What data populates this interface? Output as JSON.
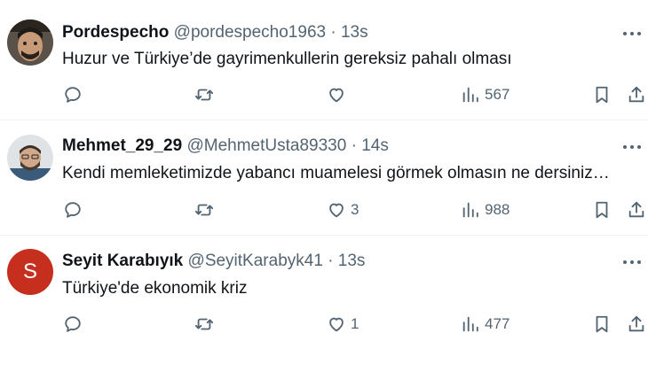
{
  "tweets": [
    {
      "name": "Pordespecho",
      "handle": "@pordespecho1963",
      "separator": "·",
      "time": "13s",
      "text": "Huzur ve Türkiye’de gayrimenkullerin gereksiz pahalı olması",
      "avatar_letter": "",
      "likes": "",
      "views": "567"
    },
    {
      "name": "Mehmet_29_29",
      "handle": "@MehmetUsta89330",
      "separator": "·",
      "time": "14s",
      "text": "Kendi memleketimizde yabancı muamelesi görmek olmasın ne dersiniz…",
      "avatar_letter": "",
      "likes": "3",
      "views": "988"
    },
    {
      "name": "Seyit Karabıyık",
      "handle": "@SeyitKarabyk41",
      "separator": "·",
      "time": "13s",
      "text": "Türkiye'de ekonomik kriz",
      "avatar_letter": "S",
      "likes": "1",
      "views": "477"
    }
  ],
  "colors": {
    "text": "#0f1419",
    "secondary": "#536471",
    "divider": "#eff3f4",
    "avatar_s": "#c62f1e"
  },
  "icons": [
    "reply-icon",
    "retweet-icon",
    "like-icon",
    "views-icon",
    "bookmark-icon",
    "share-icon",
    "more-icon"
  ]
}
